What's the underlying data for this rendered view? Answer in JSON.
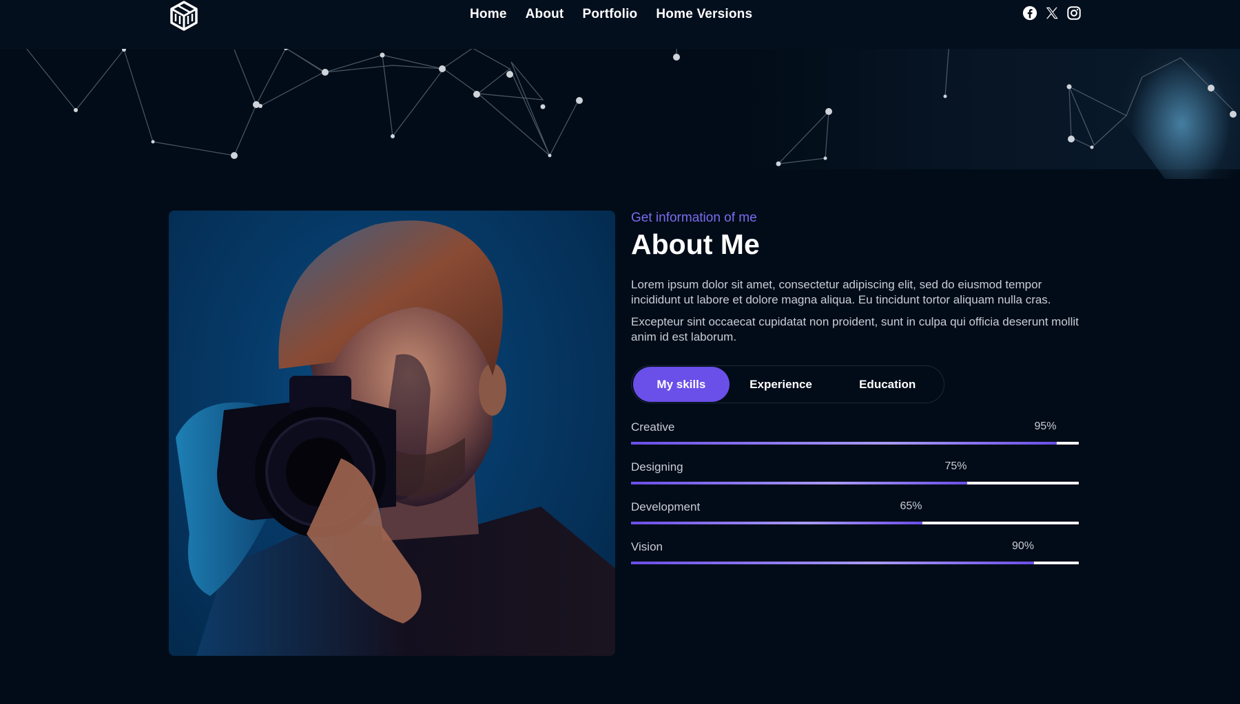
{
  "nav": {
    "items": [
      "Home",
      "About",
      "Portfolio",
      "Home Versions"
    ]
  },
  "social": {
    "icons": [
      "facebook-icon",
      "x-twitter-icon",
      "instagram-icon"
    ]
  },
  "about": {
    "eyebrow": "Get information of me",
    "title": "About Me",
    "paragraph1": "Lorem ipsum dolor sit amet, consectetur adipiscing elit, sed do eiusmod tempor incididunt ut labore et dolore magna aliqua. Eu tincidunt tortor aliquam nulla cras.",
    "paragraph2": "Excepteur sint occaecat cupidatat non proident, sunt in culpa qui officia deserunt mollit anim id est laborum."
  },
  "tabs": [
    "My skills",
    "Experience",
    "Education"
  ],
  "active_tab": "My skills",
  "skills": [
    {
      "name": "Creative",
      "percent_label": "95%",
      "value": 95
    },
    {
      "name": "Designing",
      "percent_label": "75%",
      "value": 75
    },
    {
      "name": "Development",
      "percent_label": "65%",
      "value": 65
    },
    {
      "name": "Vision",
      "percent_label": "90%",
      "value": 90
    }
  ],
  "colors": {
    "background": "#020c18",
    "accent": "#6a4fe8",
    "eyebrow": "#7b6cf0",
    "text_muted": "#c9ced6",
    "photo_blue": "#0a4f86"
  }
}
